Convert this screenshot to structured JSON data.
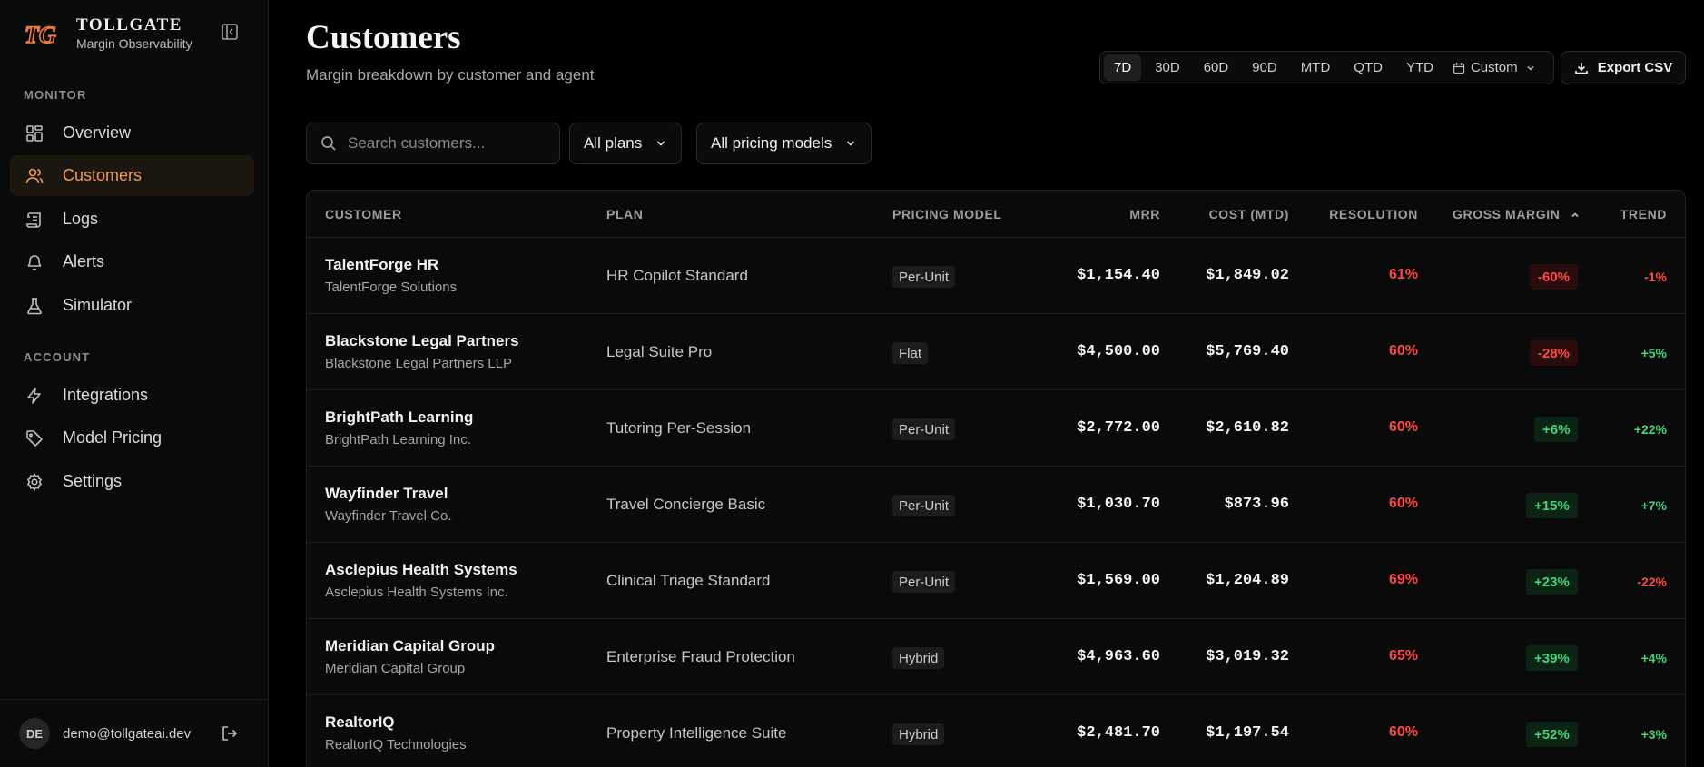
{
  "brand": {
    "name": "TOLLGATE",
    "subtitle": "Margin Observability",
    "logo_text": "TG"
  },
  "sidebar": {
    "monitor_label": "MONITOR",
    "account_label": "ACCOUNT",
    "monitor_items": [
      {
        "label": "Overview",
        "icon": "grid-icon"
      },
      {
        "label": "Customers",
        "icon": "users-icon",
        "active": true
      },
      {
        "label": "Logs",
        "icon": "scroll-icon"
      },
      {
        "label": "Alerts",
        "icon": "bell-icon"
      },
      {
        "label": "Simulator",
        "icon": "flask-icon"
      }
    ],
    "account_items": [
      {
        "label": "Integrations",
        "icon": "bolt-icon"
      },
      {
        "label": "Model Pricing",
        "icon": "tag-icon"
      },
      {
        "label": "Settings",
        "icon": "gear-icon"
      }
    ],
    "user": {
      "initials": "DE",
      "email": "demo@tollgateai.dev"
    }
  },
  "header": {
    "title": "Customers",
    "subtitle": "Margin breakdown by customer and agent",
    "ranges": [
      "7D",
      "30D",
      "60D",
      "90D",
      "MTD",
      "QTD",
      "YTD"
    ],
    "active_range": "7D",
    "custom_label": "Custom",
    "export_label": "Export CSV"
  },
  "filters": {
    "search_placeholder": "Search customers...",
    "plan_filter": "All plans",
    "pricing_filter": "All pricing models"
  },
  "table": {
    "columns": [
      "CUSTOMER",
      "PLAN",
      "PRICING MODEL",
      "MRR",
      "COST (MTD)",
      "RESOLUTION",
      "GROSS MARGIN",
      "TREND"
    ],
    "rows": [
      {
        "name": "TalentForge HR",
        "company": "TalentForge Solutions",
        "plan": "HR Copilot Standard",
        "pricing_model": "Per-Unit",
        "mrr": "$1,154.40",
        "cost": "$1,849.02",
        "resolution": "61%",
        "gross_margin": "-60%",
        "gm_positive": false,
        "trend": "-1%",
        "trend_positive": false
      },
      {
        "name": "Blackstone Legal Partners",
        "company": "Blackstone Legal Partners LLP",
        "plan": "Legal Suite Pro",
        "pricing_model": "Flat",
        "mrr": "$4,500.00",
        "cost": "$5,769.40",
        "resolution": "60%",
        "gross_margin": "-28%",
        "gm_positive": false,
        "trend": "+5%",
        "trend_positive": true
      },
      {
        "name": "BrightPath Learning",
        "company": "BrightPath Learning Inc.",
        "plan": "Tutoring Per-Session",
        "pricing_model": "Per-Unit",
        "mrr": "$2,772.00",
        "cost": "$2,610.82",
        "resolution": "60%",
        "gross_margin": "+6%",
        "gm_positive": true,
        "trend": "+22%",
        "trend_positive": true
      },
      {
        "name": "Wayfinder Travel",
        "company": "Wayfinder Travel Co.",
        "plan": "Travel Concierge Basic",
        "pricing_model": "Per-Unit",
        "mrr": "$1,030.70",
        "cost": "$873.96",
        "resolution": "60%",
        "gross_margin": "+15%",
        "gm_positive": true,
        "trend": "+7%",
        "trend_positive": true
      },
      {
        "name": "Asclepius Health Systems",
        "company": "Asclepius Health Systems Inc.",
        "plan": "Clinical Triage Standard",
        "pricing_model": "Per-Unit",
        "mrr": "$1,569.00",
        "cost": "$1,204.89",
        "resolution": "69%",
        "gross_margin": "+23%",
        "gm_positive": true,
        "trend": "-22%",
        "trend_positive": false
      },
      {
        "name": "Meridian Capital Group",
        "company": "Meridian Capital Group",
        "plan": "Enterprise Fraud Protection",
        "pricing_model": "Hybrid",
        "mrr": "$4,963.60",
        "cost": "$3,019.32",
        "resolution": "65%",
        "gross_margin": "+39%",
        "gm_positive": true,
        "trend": "+4%",
        "trend_positive": true
      },
      {
        "name": "RealtorIQ",
        "company": "RealtorIQ Technologies",
        "plan": "Property Intelligence Suite",
        "pricing_model": "Hybrid",
        "mrr": "$2,481.70",
        "cost": "$1,197.54",
        "resolution": "60%",
        "gross_margin": "+52%",
        "gm_positive": true,
        "trend": "+3%",
        "trend_positive": true
      }
    ]
  },
  "colors": {
    "accent": "#ef9a5b",
    "negative": "#ff4a4a",
    "positive": "#45d27a"
  }
}
